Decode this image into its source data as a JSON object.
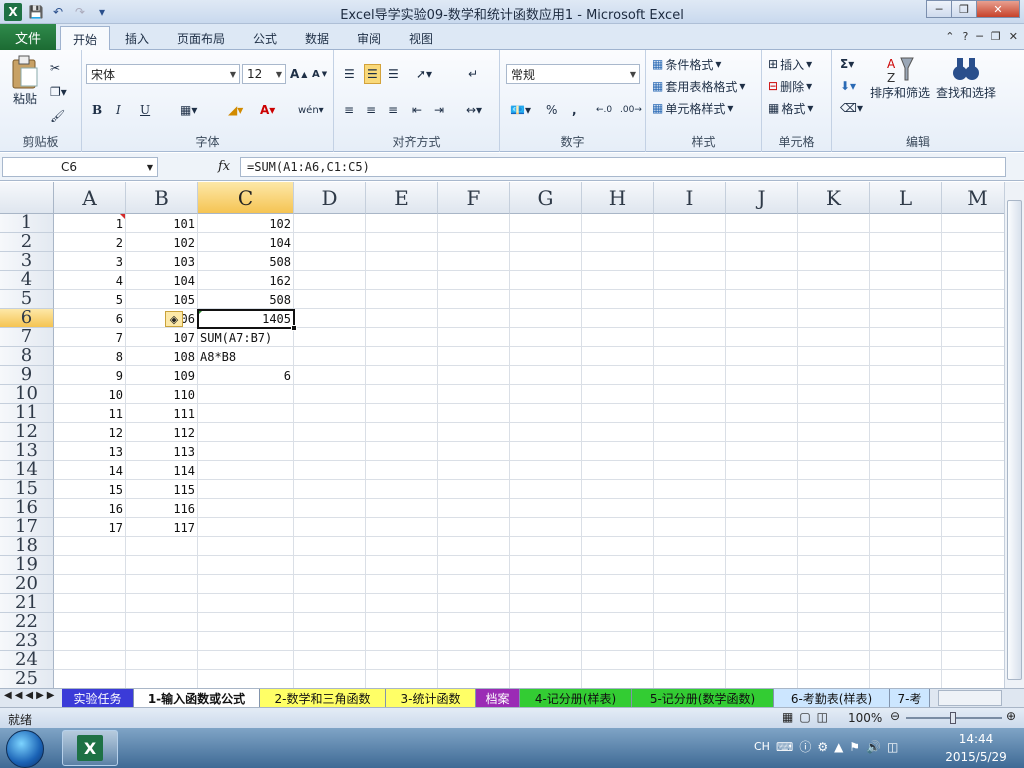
{
  "window": {
    "title": "Excel导学实验09-数学和统计函数应用1 - Microsoft Excel"
  },
  "ribbon_tabs": [
    "文件",
    "开始",
    "插入",
    "页面布局",
    "公式",
    "数据",
    "审阅",
    "视图"
  ],
  "active_tab": "开始",
  "ribbon": {
    "clipboard": {
      "paste": "粘贴",
      "label": "剪贴板"
    },
    "font": {
      "name": "宋体",
      "size": "12",
      "bold": "B",
      "italic": "I",
      "underline": "U",
      "label": "字体"
    },
    "alignment": {
      "label": "对齐方式"
    },
    "number": {
      "format": "常规",
      "percent": "%",
      "comma": ",",
      "label": "数字"
    },
    "styles": {
      "conditional": "条件格式",
      "table": "套用表格格式",
      "cell": "单元格样式",
      "label": "样式"
    },
    "cells": {
      "insert": "插入",
      "delete": "删除",
      "format": "格式",
      "label": "单元格"
    },
    "editing": {
      "sort": "排序和筛选",
      "find": "查找和选择",
      "label": "编辑"
    }
  },
  "formula_bar": {
    "name_box": "C6",
    "fx": "fx",
    "formula": "=SUM(A1:A6,C1:C5)"
  },
  "columns": [
    "A",
    "B",
    "C",
    "D",
    "E",
    "F",
    "G",
    "H",
    "I",
    "J",
    "K",
    "L",
    "M"
  ],
  "rows": [
    "1",
    "2",
    "3",
    "4",
    "5",
    "6",
    "7",
    "8",
    "9",
    "10",
    "11",
    "12",
    "13",
    "14",
    "15",
    "16",
    "17",
    "18",
    "19",
    "20",
    "21",
    "22",
    "23",
    "24",
    "25"
  ],
  "selected_cell": {
    "col": "C",
    "row": "6"
  },
  "cells": {
    "A": [
      "1",
      "2",
      "3",
      "4",
      "5",
      "6",
      "7",
      "8",
      "9",
      "10",
      "11",
      "12",
      "13",
      "14",
      "15",
      "16",
      "17"
    ],
    "B": [
      "101",
      "102",
      "103",
      "104",
      "105",
      "106",
      "107",
      "108",
      "109",
      "110",
      "111",
      "112",
      "113",
      "114",
      "115",
      "116",
      "117"
    ],
    "C": [
      "102",
      "104",
      "508",
      "162",
      "508",
      "1405",
      "SUM(A7:B7)",
      "A8*B8",
      "6"
    ]
  },
  "sheet_tabs": [
    {
      "label": "实验任务",
      "color": "#3b3bd8"
    },
    {
      "label": "1-输入函数或公式",
      "color": "#ffffff"
    },
    {
      "label": "2-数学和三角函数",
      "color": "#ffff66"
    },
    {
      "label": "3-统计函数",
      "color": "#ffff66"
    },
    {
      "label": "档案",
      "color": "#9b2bb5"
    },
    {
      "label": "4-记分册(样表)",
      "color": "#33cc33"
    },
    {
      "label": "5-记分册(数学函数)",
      "color": "#33cc33"
    },
    {
      "label": "6-考勤表(样表)",
      "color": "#cce6ff"
    },
    {
      "label": "7-考",
      "color": "#cce6ff"
    }
  ],
  "status": {
    "ready": "就绪",
    "zoom": "100%"
  },
  "taskbar": {
    "lang": "CH",
    "time": "14:44",
    "date": "2015/5/29"
  }
}
